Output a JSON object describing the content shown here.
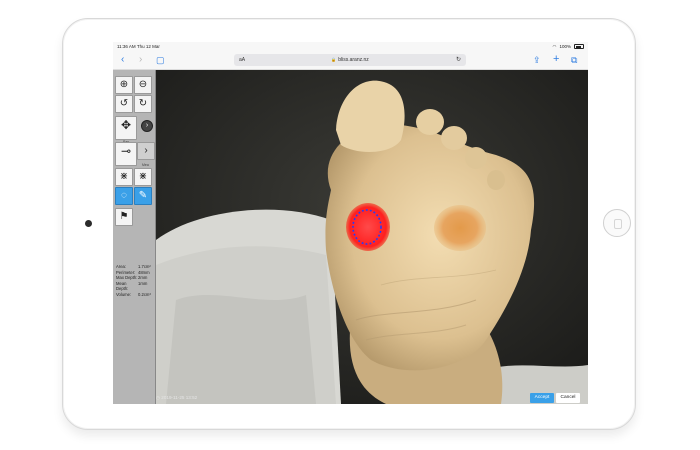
{
  "device": {
    "type": "iPad"
  },
  "status_bar": {
    "time": "11:36 AM",
    "date": "Thu 12 Mar",
    "battery": "100%"
  },
  "browser": {
    "url": "bliss.aranz.nz",
    "text_size_label": "aA"
  },
  "toolbar": {
    "tools": [
      {
        "name": "zoom-in",
        "icon": "zoom-in-icon"
      },
      {
        "name": "zoom-out",
        "icon": "zoom-out-icon"
      },
      {
        "name": "rotate-left",
        "icon": "rotate-left-icon"
      },
      {
        "name": "rotate-right",
        "icon": "rotate-right-icon"
      },
      {
        "name": "pan",
        "icon": "move-icon",
        "label": "Pan"
      },
      {
        "name": "measure",
        "icon": "ruler-icon",
        "label": "Mea"
      },
      {
        "name": "trace-a",
        "icon": "crosshair-icon"
      },
      {
        "name": "trace-b",
        "icon": "crosshair-icon"
      },
      {
        "name": "outline-tool",
        "icon": "outline-icon",
        "active": true
      },
      {
        "name": "pen-tool",
        "icon": "pen-icon",
        "active": true
      },
      {
        "name": "flag-tool",
        "icon": "flag-icon"
      }
    ]
  },
  "measurements": [
    {
      "label": "Area:",
      "value": "1.7cm²"
    },
    {
      "label": "Perimeter:",
      "value": "48mm"
    },
    {
      "label": "Max Depth:",
      "value": "2mm"
    },
    {
      "label": "Mean Depth:",
      "value": "1mm"
    },
    {
      "label": "Volume:",
      "value": "0.2cm³"
    }
  ],
  "footer": {
    "timestamp": "2019-11-25 13:52",
    "accept_label": "Accept",
    "cancel_label": "Cancel"
  },
  "colors": {
    "accent": "#3aa0e8",
    "outline": "#1f3cff",
    "wound": "#ff2a2a"
  }
}
